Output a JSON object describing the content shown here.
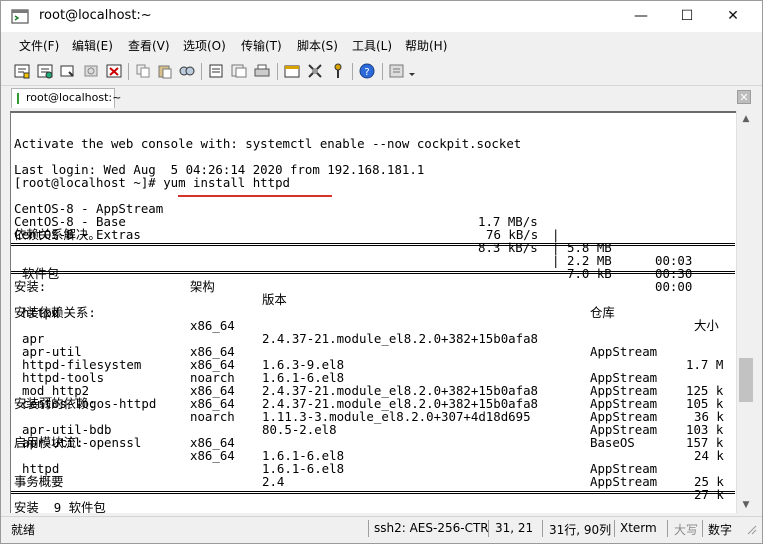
{
  "window": {
    "title": "root@localhost:~",
    "minimize": "—",
    "maximize": "☐",
    "close": "✕"
  },
  "menu": [
    "文件(F)",
    "编辑(E)",
    "查看(V)",
    "选项(O)",
    "传输(T)",
    "脚本(S)",
    "工具(L)",
    "帮助(H)"
  ],
  "toolbar_icons": [
    "new-session-icon",
    "open-session-icon",
    "reconnect-icon",
    "disconnect-icon",
    "close-session-icon",
    "copy-icon",
    "paste-icon",
    "find-icon",
    "print-setup-icon",
    "print-icon",
    "printer-icon",
    "session-options-icon",
    "global-options-icon",
    "keymap-icon",
    "help-icon",
    "script-icon"
  ],
  "tab": {
    "label": "root@localhost:~",
    "close": "✕"
  },
  "terminal": {
    "line_activate": "Activate the web console with: systemctl enable --now cockpit.socket",
    "line_login": "Last login: Wed Aug  5 04:26:14 2020 from 192.168.181.1",
    "line_cmd": "[root@localhost ~]# yum install httpd",
    "repos": [
      {
        "name": "CentOS-8 - AppStream",
        "rate": "1.7 MB/s",
        "size": "5.8 MB",
        "time": "00:03"
      },
      {
        "name": "CentOS-8 - Base",
        "rate": "76 kB/s",
        "size": "2.2 MB",
        "time": "00:30"
      },
      {
        "name": "CentOS-8 - Extras",
        "rate": "8.3 kB/s",
        "size": "7.0 kB",
        "time": "00:00"
      }
    ],
    "resolving": "依赖关系解决。",
    "headers": {
      "pkg": "软件包",
      "arch": "架构",
      "ver": "版本",
      "repo": "仓库",
      "size": "大小"
    },
    "installing": "安装:",
    "installing_deps": "安装依赖关系:",
    "installing_weak": "安装弱的依赖:",
    "enabling_modules": "启用模块流:",
    "summary": "事务概要",
    "install_summary": "安装  9 软件包",
    "packages": [
      {
        "pkg": "httpd",
        "arch": "x86_64",
        "ver": "2.4.37-21.module_el8.2.0+382+15b0afa8",
        "repo": "AppStream",
        "size": "1.7 M"
      },
      {
        "pkg": "apr",
        "arch": "x86_64",
        "ver": "1.6.3-9.el8",
        "repo": "AppStream",
        "size": "125 k"
      },
      {
        "pkg": "apr-util",
        "arch": "x86_64",
        "ver": "1.6.1-6.el8",
        "repo": "AppStream",
        "size": "105 k"
      },
      {
        "pkg": "httpd-filesystem",
        "arch": "noarch",
        "ver": "2.4.37-21.module_el8.2.0+382+15b0afa8",
        "repo": "AppStream",
        "size": "36 k"
      },
      {
        "pkg": "httpd-tools",
        "arch": "x86_64",
        "ver": "2.4.37-21.module_el8.2.0+382+15b0afa8",
        "repo": "AppStream",
        "size": "103 k"
      },
      {
        "pkg": "mod_http2",
        "arch": "x86_64",
        "ver": "1.11.3-3.module_el8.2.0+307+4d18d695",
        "repo": "AppStream",
        "size": "157 k"
      },
      {
        "pkg": "centos-logos-httpd",
        "arch": "noarch",
        "ver": "80.5-2.el8",
        "repo": "BaseOS",
        "size": "24 k"
      },
      {
        "pkg": "apr-util-bdb",
        "arch": "x86_64",
        "ver": "1.6.1-6.el8",
        "repo": "AppStream",
        "size": "25 k"
      },
      {
        "pkg": "apr-util-openssl",
        "arch": "x86_64",
        "ver": "1.6.1-6.el8",
        "repo": "AppStream",
        "size": "27 k"
      },
      {
        "pkg": "httpd",
        "arch": "",
        "ver": "2.4",
        "repo": "",
        "size": ""
      }
    ]
  },
  "status": {
    "ready": "就绪",
    "ssh": "ssh2: AES-256-CTR",
    "pos": "31,  21",
    "rowscols": "31行, 90列",
    "term": "Xterm",
    "caps": "大写",
    "num": "数字"
  },
  "colors": {
    "red_underline": "#d9322b",
    "terminal_bg": "#ffffff",
    "chrome": "#f0f0f0"
  }
}
